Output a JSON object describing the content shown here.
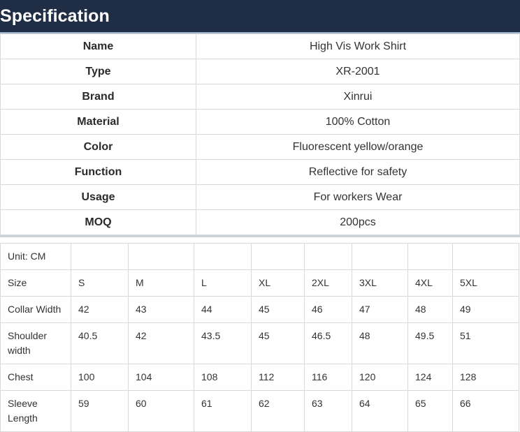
{
  "header": {
    "title": "Specification"
  },
  "spec_rows": [
    {
      "key": "Name",
      "value": "High Vis Work Shirt"
    },
    {
      "key": "Type",
      "value": "XR-2001"
    },
    {
      "key": "Brand",
      "value": "Xinrui"
    },
    {
      "key": "Material",
      "value": "100% Cotton"
    },
    {
      "key": "Color",
      "value": "Fluorescent yellow/orange"
    },
    {
      "key": "Function",
      "value": "Reflective for safety"
    },
    {
      "key": "Usage",
      "value": "For workers Wear"
    },
    {
      "key": "MOQ",
      "value": "200pcs"
    }
  ],
  "size_table": {
    "unit_label": "Unit: CM",
    "rows": [
      {
        "label": "Size",
        "values": [
          "S",
          "M",
          "L",
          "XL",
          "2XL",
          "3XL",
          "4XL",
          "5XL"
        ]
      },
      {
        "label": "Collar Width",
        "values": [
          "42",
          "43",
          "44",
          "45",
          "46",
          "47",
          "48",
          "49"
        ]
      },
      {
        "label": "Shoulder width",
        "values": [
          "40.5",
          "42",
          "43.5",
          "45",
          "46.5",
          "48",
          "49.5",
          "51"
        ]
      },
      {
        "label": "Chest",
        "values": [
          "100",
          "104",
          "108",
          "112",
          "116",
          "120",
          "124",
          "128"
        ]
      },
      {
        "label": "Sleeve Length",
        "values": [
          "59",
          "60",
          "61",
          "62",
          "63",
          "64",
          "65",
          "66"
        ]
      }
    ]
  }
}
